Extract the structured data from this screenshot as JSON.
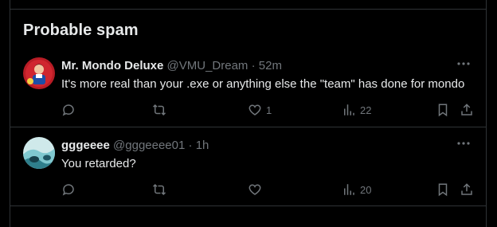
{
  "section_title": "Probable spam",
  "tweets": [
    {
      "name": "Mr. Mondo Deluxe",
      "handle": "@VMU_Dream",
      "sep": "·",
      "time": "52m",
      "text": "It's more real than your .exe or anything else the \"team\" has done for mondo",
      "likes": "1",
      "views": "22",
      "avatar_colors": [
        "#c0202a",
        "#1d4fa8"
      ]
    },
    {
      "name": "gggeeee",
      "handle": "@gggeeee01",
      "sep": "·",
      "time": "1h",
      "text": "You retarded?",
      "likes": "",
      "views": "20",
      "avatar_colors": [
        "#8fd3d8",
        "#2a6a78"
      ]
    }
  ],
  "icons": [
    "more-icon",
    "reply-icon",
    "retweet-icon",
    "like-icon",
    "views-icon",
    "bookmark-icon",
    "share-icon"
  ]
}
